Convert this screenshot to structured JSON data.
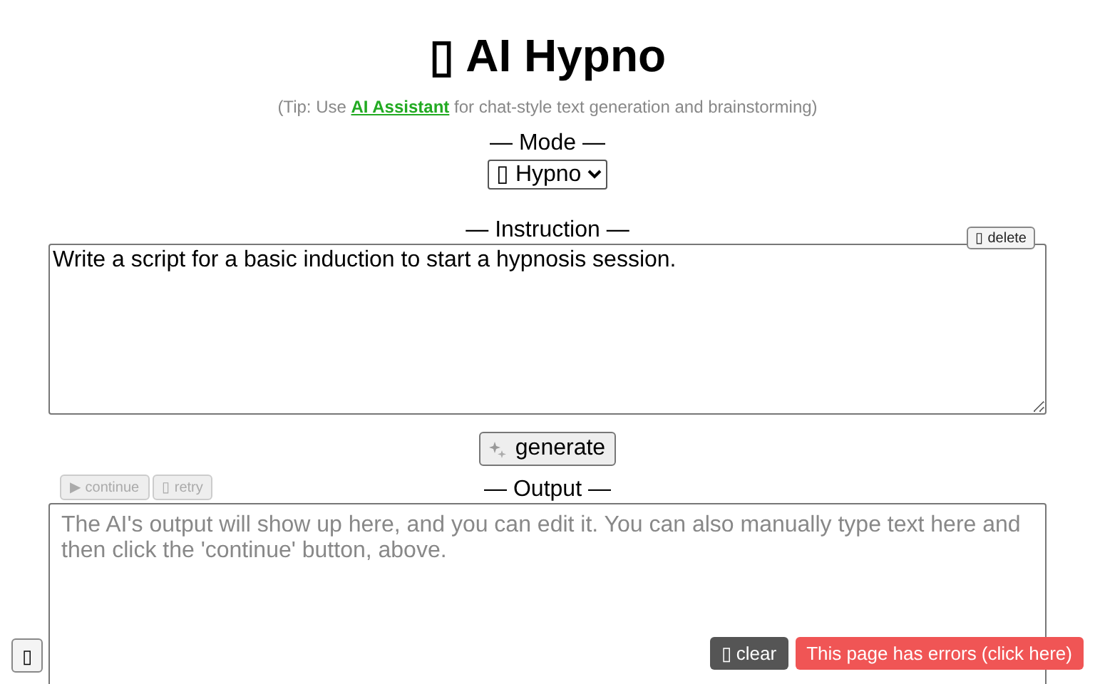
{
  "title": "▯ AI Hypno",
  "tip": {
    "before": "(Tip: Use ",
    "link": "AI Assistant",
    "after": " for chat-style text generation and brainstorming)"
  },
  "mode": {
    "label": "— Mode —",
    "value": "▯ Hypno"
  },
  "instruction": {
    "label": "— Instruction —",
    "value": "Write a script for a basic induction to start a hypnosis session.",
    "delete_button": "▯ delete"
  },
  "generate_button": "generate",
  "output": {
    "label": "— Output —",
    "placeholder": "The AI's output will show up here, and you can edit it. You can also manually type text here and then click the 'continue' button, above.",
    "actions": [
      {
        "label": "▶ continue",
        "disabled": true
      },
      {
        "label": "▯ retry",
        "disabled": true
      }
    ]
  },
  "corner_button": "▯",
  "clear_button": "▯ clear",
  "error_button": "This page has errors (click here)"
}
